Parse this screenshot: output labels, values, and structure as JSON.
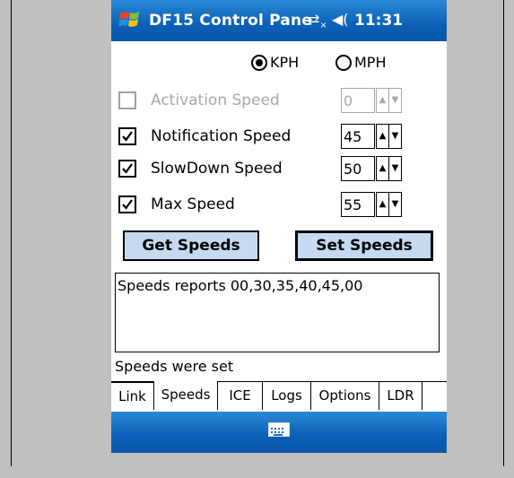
{
  "titlebar": {
    "title": "DF15 Control Pane",
    "clock": "11:31",
    "icons": [
      "windows-start-icon",
      "connectivity-icon",
      "volume-icon"
    ]
  },
  "units": {
    "options": [
      "KPH",
      "MPH"
    ],
    "selected": "KPH"
  },
  "speeds": [
    {
      "label": "Activation Speed",
      "checked": false,
      "enabled": false,
      "value": "0"
    },
    {
      "label": "Notification Speed",
      "checked": true,
      "enabled": true,
      "value": "45"
    },
    {
      "label": "SlowDown Speed",
      "checked": true,
      "enabled": true,
      "value": "50"
    },
    {
      "label": "Max Speed",
      "checked": true,
      "enabled": true,
      "value": "55"
    }
  ],
  "buttons": {
    "get": "Get Speeds",
    "set": "Set Speeds"
  },
  "log_text": "Speeds reports 00,30,35,40,45,00",
  "status_text": "Speeds were set",
  "tabs": [
    "Link",
    "Speeds",
    "ICE",
    "Logs",
    "Options",
    "LDR"
  ],
  "active_tab": "Speeds",
  "taskbar": {
    "icon": "keyboard-icon"
  }
}
